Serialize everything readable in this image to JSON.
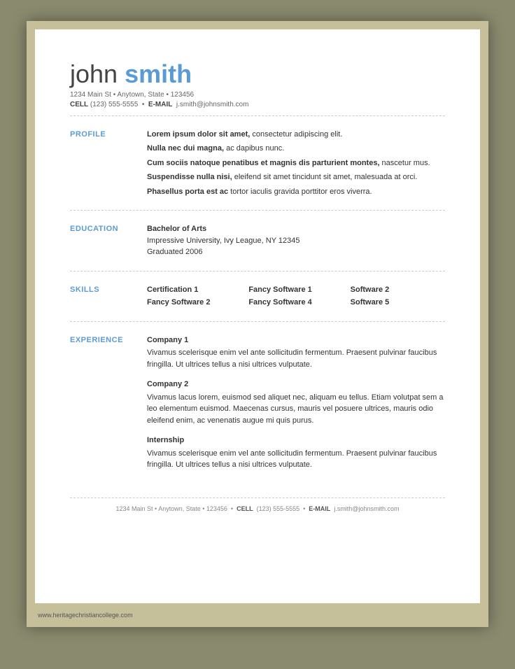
{
  "header": {
    "first_name": "john",
    "last_name": "smith",
    "address": "1234 Main St • Anytown, State • 123456",
    "cell_label": "CELL",
    "cell": "(123) 555-5555",
    "email_label": "E-MAIL",
    "email": "j.smith@johnsmith.com"
  },
  "sections": {
    "profile": {
      "label": "PROFILE",
      "paragraphs": [
        {
          "bold": "Lorem ipsum dolor sit amet,",
          "rest": " consectetur adipiscing elit."
        },
        {
          "bold": "Nulla nec dui magna,",
          "rest": " ac dapibus nunc."
        },
        {
          "bold": "Cum sociis natoque penatibus et magnis dis parturient montes,",
          "rest": " nascetur mus."
        },
        {
          "bold": "Suspendisse nulla nisi,",
          "rest": " eleifend sit amet tincidunt sit amet, malesuada at orci."
        },
        {
          "bold": "Phasellus porta est ac",
          "rest": " tortor iaculis gravida porttitor eros viverra."
        }
      ]
    },
    "education": {
      "label": "EDUCATION",
      "degree": "Bachelor of Arts",
      "school": "Impressive University, Ivy League, NY 12345",
      "graduated": "Graduated 2006"
    },
    "skills": {
      "label": "SKILLS",
      "items": [
        "Certification 1",
        "Fancy Software 1",
        "Software 2",
        "Fancy Software 2",
        "Fancy Software 4",
        "Software 5"
      ]
    },
    "experience": {
      "label": "EXPERIENCE",
      "entries": [
        {
          "company": "Company 1",
          "description": "Vivamus scelerisque enim vel ante sollicitudin fermentum. Praesent pulvinar faucibus fringilla. Ut ultrices tellus a nisi ultrices vulputate."
        },
        {
          "company": "Company 2",
          "description": "Vivamus lacus lorem, euismod sed aliquet nec, aliquam eu tellus. Etiam volutpat sem a leo elementum euismod. Maecenas cursus, mauris vel posuere ultrices, mauris odio eleifend enim, ac venenatis augue mi quis purus."
        },
        {
          "company": "Internship",
          "description": "Vivamus scelerisque enim vel ante sollicitudin fermentum. Praesent pulvinar faucibus fringilla. Ut ultrices tellus a nisi ultrices vulputate."
        }
      ]
    }
  },
  "footer": {
    "address": "1234 Main St • Anytown, State • 123456",
    "cell_label": "CELL",
    "cell": "(123) 555-5555",
    "email_label": "E-MAIL",
    "email": "j.smith@johnsmith.com"
  },
  "website": "www.heritagechristiancollege.com"
}
